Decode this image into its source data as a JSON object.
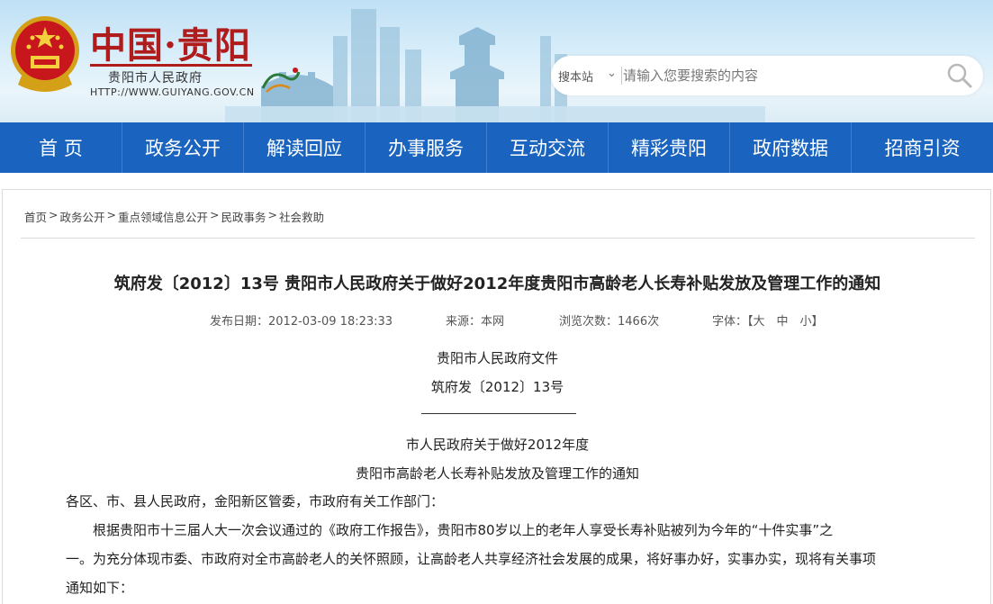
{
  "header": {
    "site_title": "中国·贵阳",
    "site_subtitle": "贵阳市人民政府",
    "site_url": "HTTP://WWW.GUIYANG.GOV.CN",
    "search": {
      "scope": "搜本站",
      "placeholder": "请输入您要搜索的内容"
    }
  },
  "nav": {
    "items": [
      {
        "label": "首 页"
      },
      {
        "label": "政务公开"
      },
      {
        "label": "解读回应"
      },
      {
        "label": "办事服务"
      },
      {
        "label": "互动交流"
      },
      {
        "label": "精彩贵阳"
      },
      {
        "label": "政府数据"
      },
      {
        "label": "招商引资"
      }
    ]
  },
  "breadcrumb": {
    "items": [
      "首页",
      "政务公开",
      "重点领域信息公开",
      "民政事务",
      "社会救助"
    ],
    "separator": ">"
  },
  "article": {
    "title": "筑府发〔2012〕13号 贵阳市人民政府关于做好2012年度贵阳市高龄老人长寿补贴发放及管理工作的通知",
    "meta": {
      "date": "发布日期：2012-03-09 18:23:33",
      "source": "来源：本网",
      "views": "浏览次数：1466次",
      "font_size": "字体：【大　中　小】"
    },
    "header_line1": "贵阳市人民政府文件",
    "header_line2": "筑府发〔2012〕13号",
    "subtitle_line1": "市人民政府关于做好2012年度",
    "subtitle_line2": "贵阳市高龄老人长寿补贴发放及管理工作的通知",
    "salutation": "各区、市、县人民政府，金阳新区管委，市政府有关工作部门：",
    "para1_line1": "根据贵阳市十三届人大一次会议通过的《政府工作报告》，贵阳市80岁以上的老年人享受长寿补贴被列为今年的“十件实事”之",
    "para1_line2": "一。为充分体现市委、市政府对全市高龄老人的关怀照顾，让高龄老人共享经济社会发展的成果，将好事办好，实事办实，现将有关事项",
    "para1_line3": "通知如下："
  },
  "colors": {
    "nav_bg": "#1a64bf",
    "title_red": "#b01c1c"
  }
}
